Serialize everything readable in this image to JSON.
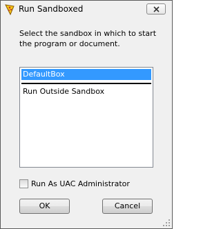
{
  "window": {
    "title": "Run Sandboxed",
    "app_icon": "sandboxie-icon",
    "close_icon": "close-icon"
  },
  "prompt": "Select the sandbox in which to start the program or document.",
  "sandbox_list": {
    "items": [
      {
        "label": "DefaultBox",
        "selected": true
      },
      {
        "label": "Run Outside Sandbox",
        "selected": false
      }
    ]
  },
  "options": {
    "run_as_uac_admin_label": "Run As UAC Administrator",
    "run_as_uac_admin_checked": false
  },
  "buttons": {
    "ok_label": "OK",
    "cancel_label": "Cancel"
  },
  "colors": {
    "selection": "#3399ff",
    "window_bg": "#f0f0f0",
    "list_bg": "#ffffff"
  }
}
